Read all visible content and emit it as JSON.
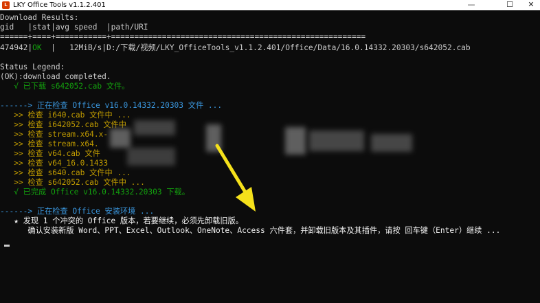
{
  "window": {
    "title": "LKY Office Tools v1.1.2.401",
    "minimize": "—",
    "maximize": "☐",
    "close": "✕"
  },
  "console": {
    "download_header": "Download Results:",
    "col_header": "gid   |stat|avg speed  |path/URI",
    "separator": "======+====+===========+=======================================================",
    "row_gid": "474942",
    "row_sep1": "|",
    "row_stat": "OK",
    "row_rest": "  |   12MiB/s|D:/下载/视频/LKY_OfficeTools_v1.1.2.401/Office/Data/16.0.14332.20303/s642052.cab",
    "status_legend": "Status Legend:",
    "ok_legend": "(OK):download completed.",
    "done_download": "   √ 已下载 s642052.cab 文件。",
    "check_office": "------> 正在检查 Office v16.0.14332.20303 文件 ...",
    "check_lines": [
      "   >> 检查 i640.cab 文件中 ...",
      "   >> 检查 i642052.cab 文件中",
      "   >> 检查 stream.x64.x-",
      "   >> 检查 stream.x64.",
      "   >> 检查 v64.cab 文件",
      "   >> 检查 v64_16.0.1433",
      "   >> 检查 s640.cab 文件中 ...",
      "   >> 检查 s642052.cab 文件中 ..."
    ],
    "done_office": "   √ 已完成 Office v16.0.14332.20303 下载。",
    "check_env": "------> 正在检查 Office 安装环境 ...",
    "conflict": "   ★ 发现 1 个冲突的 Office 版本，若要继续，必须先卸载旧版。",
    "confirm": "      确认安装新版 Word、PPT、Excel、Outlook、OneNote、Access 六件套，并卸载旧版本及其插件，请按 回车键（Enter）继续 ..."
  },
  "colors": {
    "background": "#0c0c0c",
    "text": "#cccccc",
    "green": "#13a10e",
    "cyan": "#3a96dd",
    "yellow": "#c19c00",
    "arrow": "#f5e11b"
  }
}
